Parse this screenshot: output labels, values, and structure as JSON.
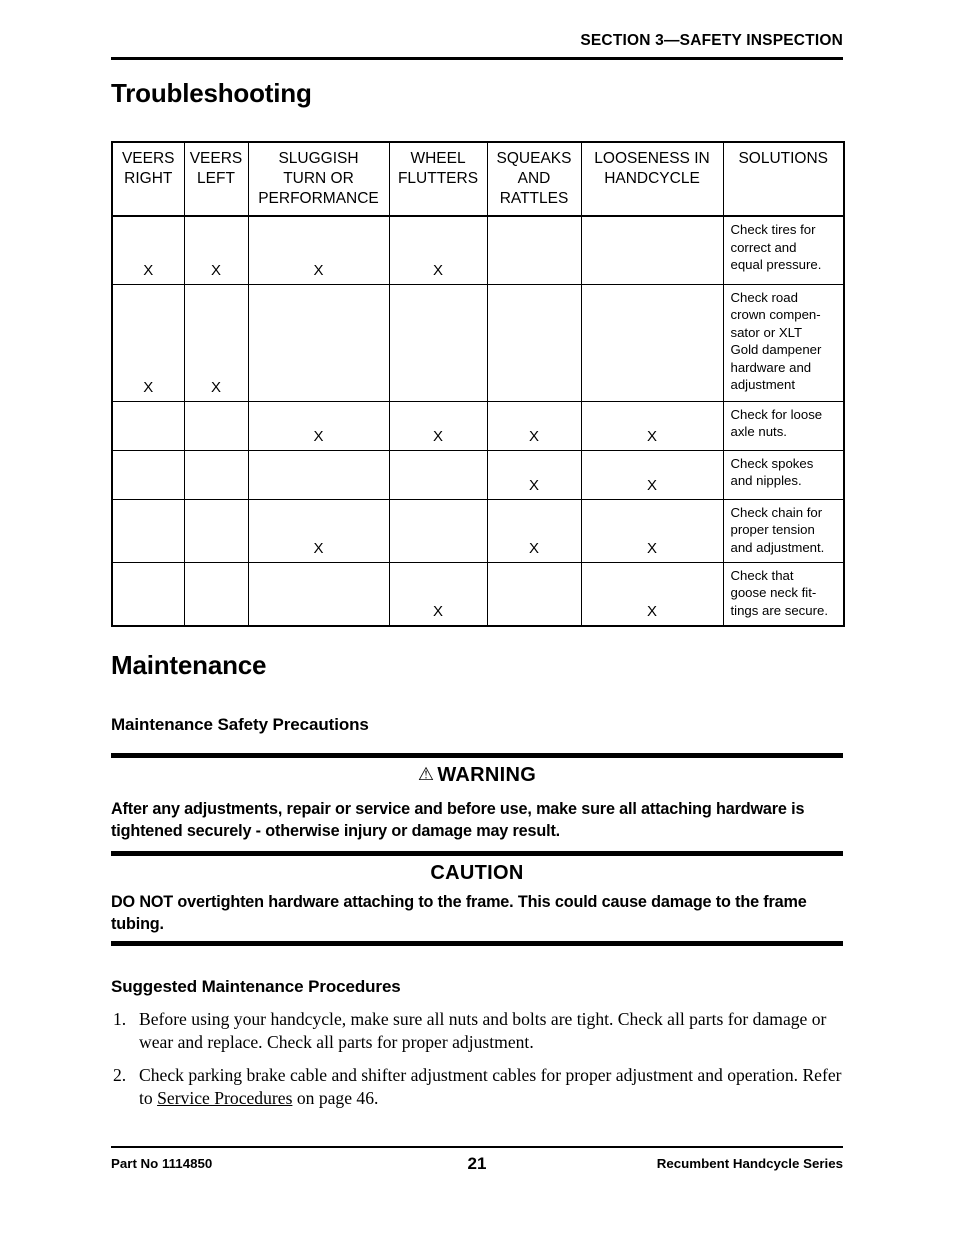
{
  "header": {
    "section_title": "SECTION 3—SAFETY INSPECTION"
  },
  "headings": {
    "troubleshooting": "Troubleshooting",
    "maintenance": "Maintenance",
    "maintenance_safety_precautions": "Maintenance Safety Precautions",
    "suggested_maintenance_procedures": "Suggested Maintenance Procedures"
  },
  "troubleshooting_table": {
    "columns": [
      "VEERS RIGHT",
      "VEERS LEFT",
      "SLUGGISH TURN OR PERFORMANCE",
      "WHEEL FLUTTERS",
      "SQUEAKS AND RATTLES",
      "LOOSENESS IN HANDCYCLE",
      "SOLUTIONS"
    ],
    "columns_lines": [
      [
        "VEERS",
        "RIGHT"
      ],
      [
        "VEERS",
        "LEFT"
      ],
      [
        "SLUGGISH",
        "TURN OR",
        "PERFORMANCE"
      ],
      [
        "WHEEL",
        "FLUTTERS"
      ],
      [
        "SQUEAKS",
        "AND",
        "RATTLES"
      ],
      [
        "LOOSENESS IN",
        "HANDCYCLE"
      ],
      [
        "SOLUTIONS"
      ]
    ],
    "mark": "X",
    "rows": [
      {
        "marks": [
          "X",
          "X",
          "X",
          "X",
          "",
          ""
        ],
        "solution": "Check tires for correct and equal pressure.",
        "solution_lines": [
          "Check tires for",
          "correct and",
          "equal pressure."
        ]
      },
      {
        "marks": [
          "X",
          "X",
          "",
          "",
          "",
          ""
        ],
        "solution": "Check road crown compensator or XLT Gold dampener hardware and adjustment",
        "solution_lines": [
          "Check road",
          "crown compen-",
          "sator or XLT",
          "Gold dampener",
          "hardware and",
          "adjustment"
        ]
      },
      {
        "marks": [
          "",
          "",
          "X",
          "X",
          "X",
          "X"
        ],
        "solution": "Check for loose axle nuts.",
        "solution_lines": [
          "Check for loose",
          "axle nuts."
        ]
      },
      {
        "marks": [
          "",
          "",
          "",
          "",
          "X",
          "X"
        ],
        "solution": "Check spokes and nipples.",
        "solution_lines": [
          "Check spokes",
          "and nipples."
        ]
      },
      {
        "marks": [
          "",
          "",
          "X",
          "",
          "X",
          "X"
        ],
        "solution": "Check chain for proper tension and adjustment.",
        "solution_lines": [
          "Check chain for",
          "proper tension",
          "and adjustment."
        ]
      },
      {
        "marks": [
          "",
          "",
          "",
          "X",
          "",
          "X"
        ],
        "solution": "Check that goose neck fittings are secure.",
        "solution_lines": [
          "Check that",
          "goose neck fit-",
          "tings are secure."
        ]
      }
    ]
  },
  "warning": {
    "icon": "warning-triangle-icon",
    "icon_glyph": "⚠",
    "title": "WARNING",
    "body": "After any adjustments, repair or service and before use, make sure all attaching hardware is tightened securely - otherwise injury or damage may result."
  },
  "caution": {
    "title": "CAUTION",
    "body_lead": "DO NOT",
    "body_rest": " overtighten hardware attaching to the frame. This could cause damage to the frame tubing."
  },
  "procedures": [
    {
      "number": "1.",
      "text": "Before using your handcycle, make sure all nuts and bolts are tight. Check all parts for damage or wear and replace. Check all parts for proper adjustment."
    },
    {
      "number": "2.",
      "text_before": "Check parking brake cable and shifter adjustment cables for proper adjustment and operation. Refer to ",
      "link_text": "Service Procedures",
      "text_after": " on page 46."
    }
  ],
  "footer": {
    "part_no": "Part No 1114850",
    "page_number": "21",
    "series": "Recumbent Handcycle Series"
  }
}
